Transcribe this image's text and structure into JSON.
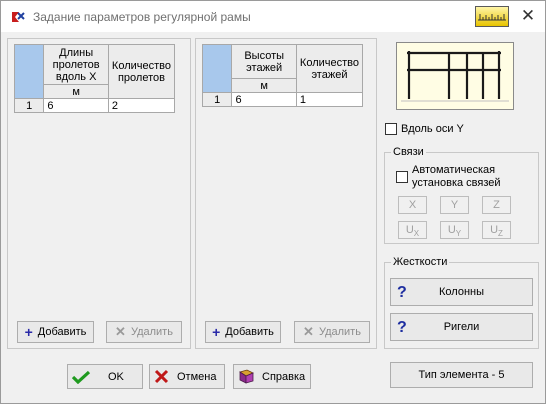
{
  "window": {
    "title": "Задание параметров регулярной рамы"
  },
  "x_panel": {
    "col1_header": "Длины пролетов вдоль X",
    "col1_unit": "м",
    "col2_header": "Количество пролетов",
    "rows": [
      {
        "num": "1",
        "length": "6",
        "count": "2"
      }
    ],
    "add_label": "Добавить",
    "delete_label": "Удалить"
  },
  "z_panel": {
    "col1_header": "Высоты этажей",
    "col1_unit": "м",
    "col2_header": "Количество этажей",
    "rows": [
      {
        "num": "1",
        "height": "6",
        "count": "1"
      }
    ],
    "add_label": "Добавить",
    "delete_label": "Удалить"
  },
  "along_y": {
    "label": "Вдоль оси Y",
    "checked": false
  },
  "links": {
    "legend": "Связи",
    "auto_label": "Автоматическая установка связей",
    "auto_checked": false,
    "axes": [
      "X",
      "Y",
      "Z",
      "U",
      "U",
      "U"
    ],
    "axes_sub": [
      "",
      "",
      "",
      "X",
      "Y",
      "Z"
    ]
  },
  "stiffness": {
    "legend": "Жесткости",
    "columns_label": "Колонны",
    "beams_label": "Ригели"
  },
  "element_type_label": "Тип элемента - 5",
  "footer": {
    "ok_label": "OK",
    "cancel_label": "Отмена",
    "help_label": "Справка"
  },
  "icons": {
    "app": "lira-app-icon",
    "ruler": "ruler-icon",
    "close": "close-icon"
  },
  "colors": {
    "header_corner": "#a8c8ec",
    "preview_bg": "#fffde4",
    "question": "#1e2ea0",
    "ok_check": "#1f9a1f",
    "cancel_x": "#c01818"
  }
}
